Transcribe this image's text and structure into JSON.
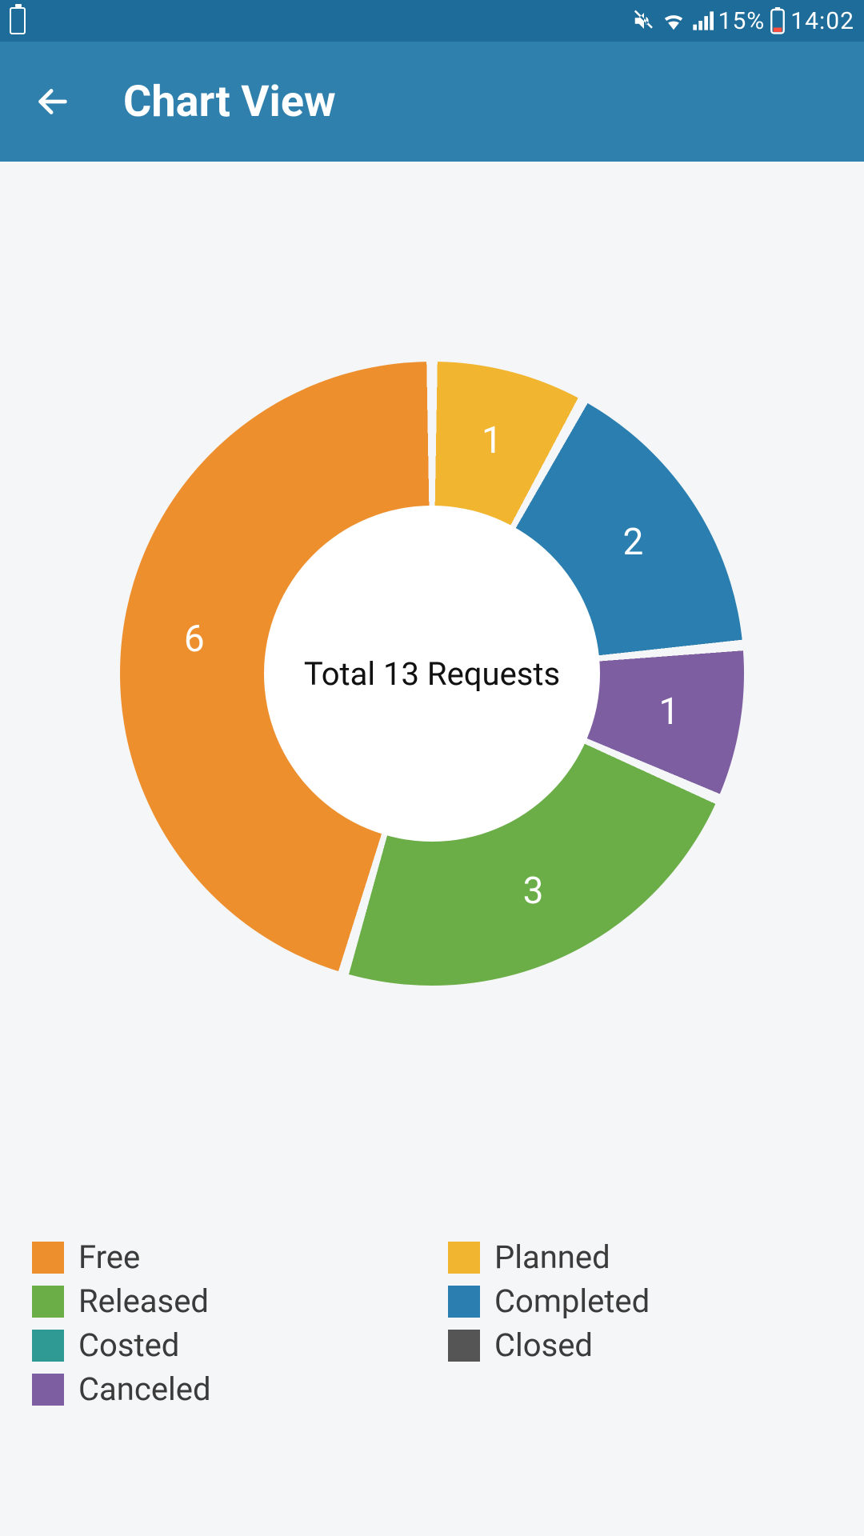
{
  "status_bar": {
    "battery_left_icon_hint": "!",
    "indicators": [
      "mute",
      "wifi",
      "signal"
    ],
    "battery_percent": "15%",
    "time": "14:02"
  },
  "app_bar": {
    "title": "Chart View"
  },
  "chart_data": {
    "type": "pie",
    "title": "Total 13 Requests",
    "categories": [
      "Planned",
      "Completed",
      "Canceled",
      "Released",
      "Free"
    ],
    "values": [
      1,
      2,
      1,
      3,
      6
    ],
    "series_colors": {
      "Planned": "#f1b530",
      "Completed": "#2a7fb0",
      "Canceled": "#7d5ea0",
      "Released": "#6bae48",
      "Free": "#ee8f2e"
    },
    "center_label": "Total 13 Requests",
    "hole_ratio": 0.54,
    "start_angle_deg": -90,
    "gap_deg": 2,
    "slice_value_labels": [
      "1",
      "2",
      "1",
      "3",
      "6"
    ],
    "legend_left": [
      "Free",
      "Released",
      "Costed",
      "Canceled"
    ],
    "legend_right": [
      "Planned",
      "Completed",
      "Closed"
    ],
    "legend_colors": {
      "Free": "#ee8f2e",
      "Released": "#6bae48",
      "Costed": "#2f9a93",
      "Canceled": "#7d5ea0",
      "Planned": "#f1b530",
      "Completed": "#2a7fb0",
      "Closed": "#555555"
    }
  },
  "legend_labels": {
    "Free": "Free",
    "Released": "Released",
    "Costed": "Costed",
    "Canceled": "Canceled",
    "Planned": "Planned",
    "Completed": "Completed",
    "Closed": "Closed"
  }
}
